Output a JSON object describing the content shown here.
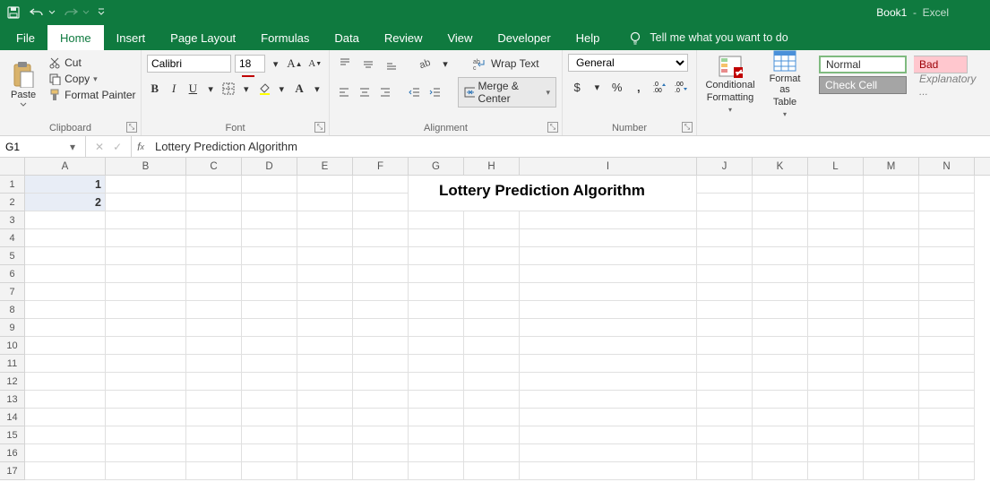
{
  "title": {
    "doc": "Book1",
    "app": "Excel"
  },
  "tabs": [
    "File",
    "Home",
    "Insert",
    "Page Layout",
    "Formulas",
    "Data",
    "Review",
    "View",
    "Developer",
    "Help"
  ],
  "active_tab": "Home",
  "tellme": "Tell me what you want to do",
  "clipboard": {
    "cut": "Cut",
    "copy": "Copy",
    "fp": "Format Painter",
    "paste": "Paste",
    "label": "Clipboard"
  },
  "font": {
    "name": "Calibri",
    "size": "18",
    "label": "Font"
  },
  "alignment": {
    "wrap": "Wrap Text",
    "merge": "Merge & Center",
    "label": "Alignment"
  },
  "number": {
    "format": "General",
    "label": "Number"
  },
  "styles": {
    "cf": "Conditional\nFormatting",
    "fat": "Format as\nTable",
    "normal": "Normal",
    "bad": "Bad",
    "check": "Check Cell",
    "expl": "Explanatory ...",
    "cf1": "Conditional",
    "cf2": "Formatting",
    "fat1": "Format as",
    "fat2": "Table"
  },
  "namebox": "G1",
  "formula": "Lottery Prediction Algorithm",
  "columns": [
    "A",
    "B",
    "C",
    "D",
    "E",
    "F",
    "G",
    "H",
    "I",
    "J",
    "K",
    "L",
    "M",
    "N"
  ],
  "cells": {
    "A1": "1",
    "A2": "2",
    "merged_title": "Lottery Prediction Algorithm"
  },
  "chart_data": null
}
